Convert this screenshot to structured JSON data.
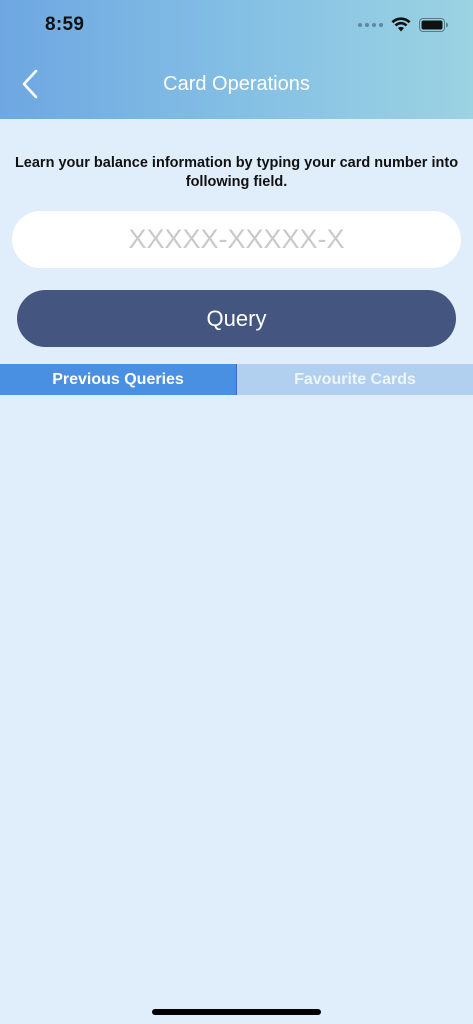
{
  "status_bar": {
    "time": "8:59"
  },
  "nav": {
    "title": "Card Operations",
    "back_icon": "chevron-left-icon"
  },
  "instructions": "Learn your balance information by typing your card number into following field.",
  "card_input": {
    "placeholder": "XXXXX-XXXXX-X",
    "value": ""
  },
  "query_button": {
    "label": "Query"
  },
  "tabs": [
    {
      "label": "Previous Queries",
      "active": true
    },
    {
      "label": "Favourite Cards",
      "active": false
    }
  ],
  "colors": {
    "header_gradient_start": "#6ea7e2",
    "header_gradient_end": "#9bd3e2",
    "background": "#e0eefb",
    "query_button": "#44567f",
    "tab_active": "#4a90e2",
    "tab_inactive": "#b1cfee"
  }
}
